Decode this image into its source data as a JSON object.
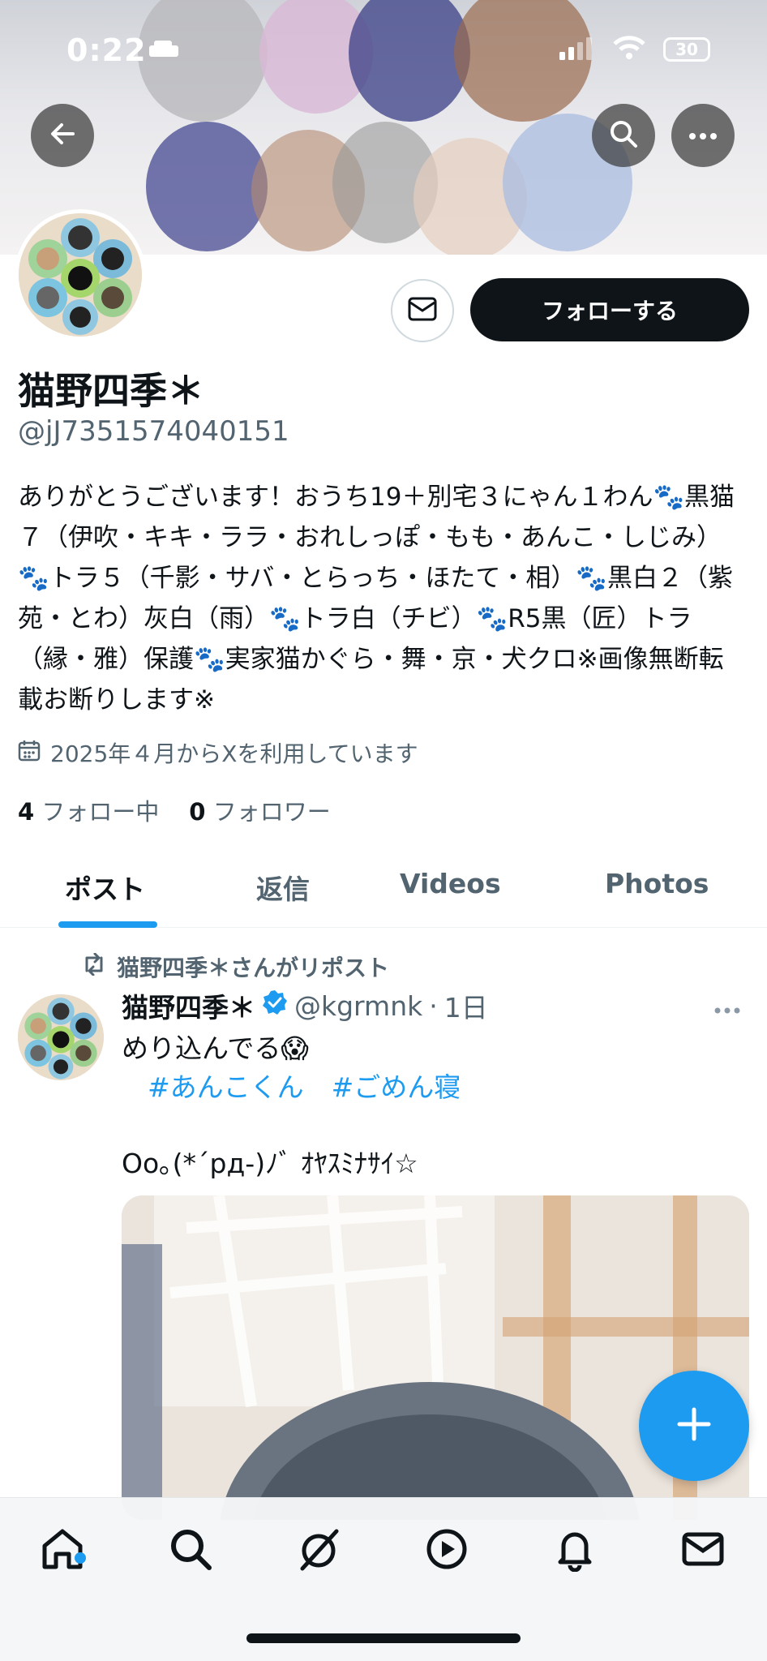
{
  "status_bar": {
    "time": "0:22",
    "battery": "30"
  },
  "profile": {
    "display_name": "猫野四季＊",
    "handle": "@jJ7351574040151",
    "bio": "ありがとうございます！おうち19＋別宅３にゃん１わん🐾黒猫７（伊吹・キキ・ララ・おれしっぽ・もも・あんこ・しじみ）🐾トラ５（千影・サバ・とらっち・ほたて・相）🐾黒白２（紫苑・とわ）灰白（雨）🐾トラ白（チビ）🐾R5黒（匠）トラ（縁・雅）保護🐾実家猫かぐら・舞・京・犬クロ※画像無断転載お断りします※",
    "joined": "2025年４月からXを利用しています",
    "following_count": "4",
    "following_label": "フォロー中",
    "followers_count": "0",
    "followers_label": "フォロワー",
    "follow_button": "フォローする"
  },
  "tabs": [
    {
      "label": "ポスト",
      "active": true
    },
    {
      "label": "返信",
      "active": false
    },
    {
      "label": "Videos",
      "active": false
    },
    {
      "label": "Photos",
      "active": false
    }
  ],
  "post": {
    "repost_label": "猫野四季＊さんがリポスト",
    "author_name": "猫野四季＊",
    "author_handle": "@kgrmnk",
    "separator": "·",
    "time": "1日",
    "text": "めり込んでる😱",
    "hashtags": [
      "#あんこくん",
      "#ごめん寝"
    ],
    "kaomoji": "Oo｡(*´pд-)ﾉﾞ ｵﾔｽﾐﾅｻｲ☆"
  },
  "colors": {
    "accent": "#1d9bf0",
    "text": "#0f1419",
    "muted": "#536471"
  },
  "icons": {
    "back": "arrow-left-icon",
    "search": "search-icon",
    "more": "more-icon",
    "mail": "mail-icon",
    "calendar": "calendar-icon",
    "repost": "repost-icon",
    "verified": "verified-badge-icon",
    "compose": "plus-icon",
    "nav": [
      "home-icon",
      "search-icon",
      "grok-icon",
      "video-icon",
      "bell-icon",
      "mail-icon"
    ]
  }
}
